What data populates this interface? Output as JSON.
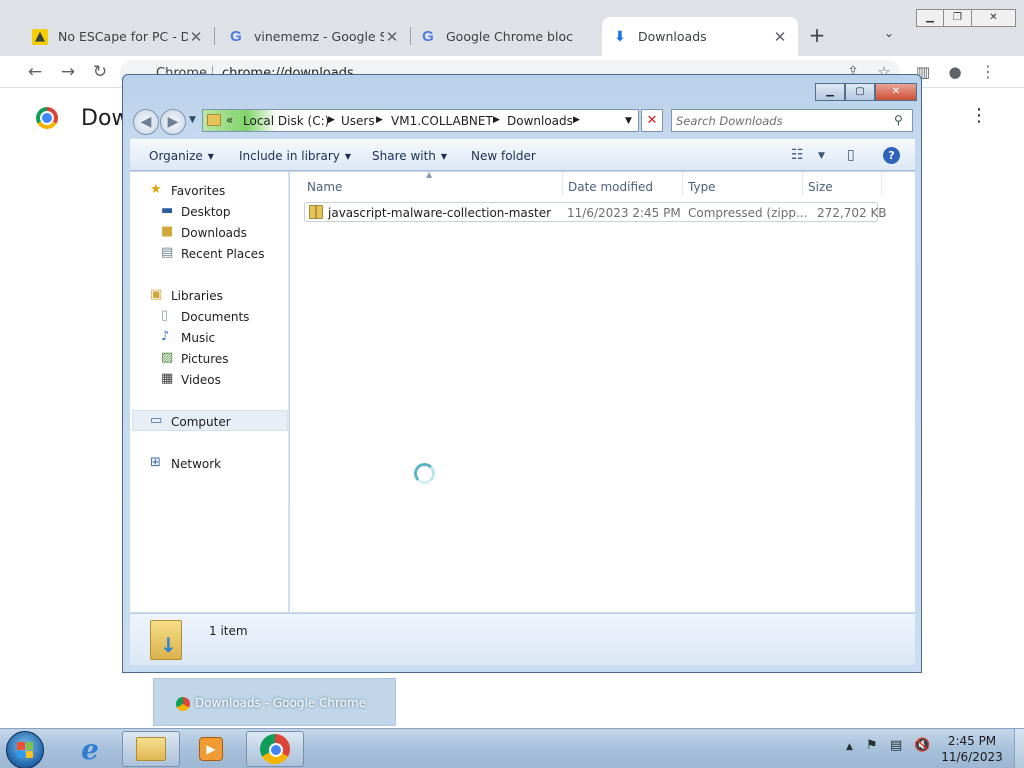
{
  "chrome": {
    "tabs": [
      {
        "title": "No ESCape for PC - DOV",
        "icon": "noescape-favicon"
      },
      {
        "title": "vinememz - Google Sea",
        "icon": "google-favicon"
      },
      {
        "title": "Google Chrome blocks",
        "icon": "google-favicon"
      },
      {
        "title": "Downloads",
        "icon": "download-favicon",
        "active": true
      }
    ],
    "omnibox_chip": "Chrome",
    "url": "chrome://downloads",
    "page_title": "Downloads"
  },
  "explorer": {
    "breadcrumb_prefix": "«",
    "breadcrumbs": [
      "Local Disk (C:)",
      "Users",
      "VM1.COLLABNET",
      "Downloads"
    ],
    "search_placeholder": "Search Downloads",
    "commands": {
      "organize": "Organize",
      "include_in_library": "Include in library",
      "share_with": "Share with",
      "new_folder": "New folder"
    },
    "nav": {
      "favorites": "Favorites",
      "desktop": "Desktop",
      "downloads": "Downloads",
      "recent_places": "Recent Places",
      "libraries": "Libraries",
      "documents": "Documents",
      "music": "Music",
      "pictures": "Pictures",
      "videos": "Videos",
      "computer": "Computer",
      "network": "Network"
    },
    "columns": {
      "name": "Name",
      "date_modified": "Date modified",
      "type": "Type",
      "size": "Size"
    },
    "files": [
      {
        "name": "javascript-malware-collection-master",
        "date_modified": "11/6/2023 2:45 PM",
        "type": "Compressed (zipp...",
        "size": "272,702 KB"
      }
    ],
    "item_count": "1 item"
  },
  "taskbar": {
    "thumbnail_title": "Downloads - Google Chrome",
    "time": "2:45 PM",
    "date": "11/6/2023"
  },
  "colors": {
    "chrome_tabstrip": "#dee1e6",
    "explorer_frame": "#c4d8ee",
    "taskbar": "#a7c0db",
    "close_red": "#c94f35"
  }
}
